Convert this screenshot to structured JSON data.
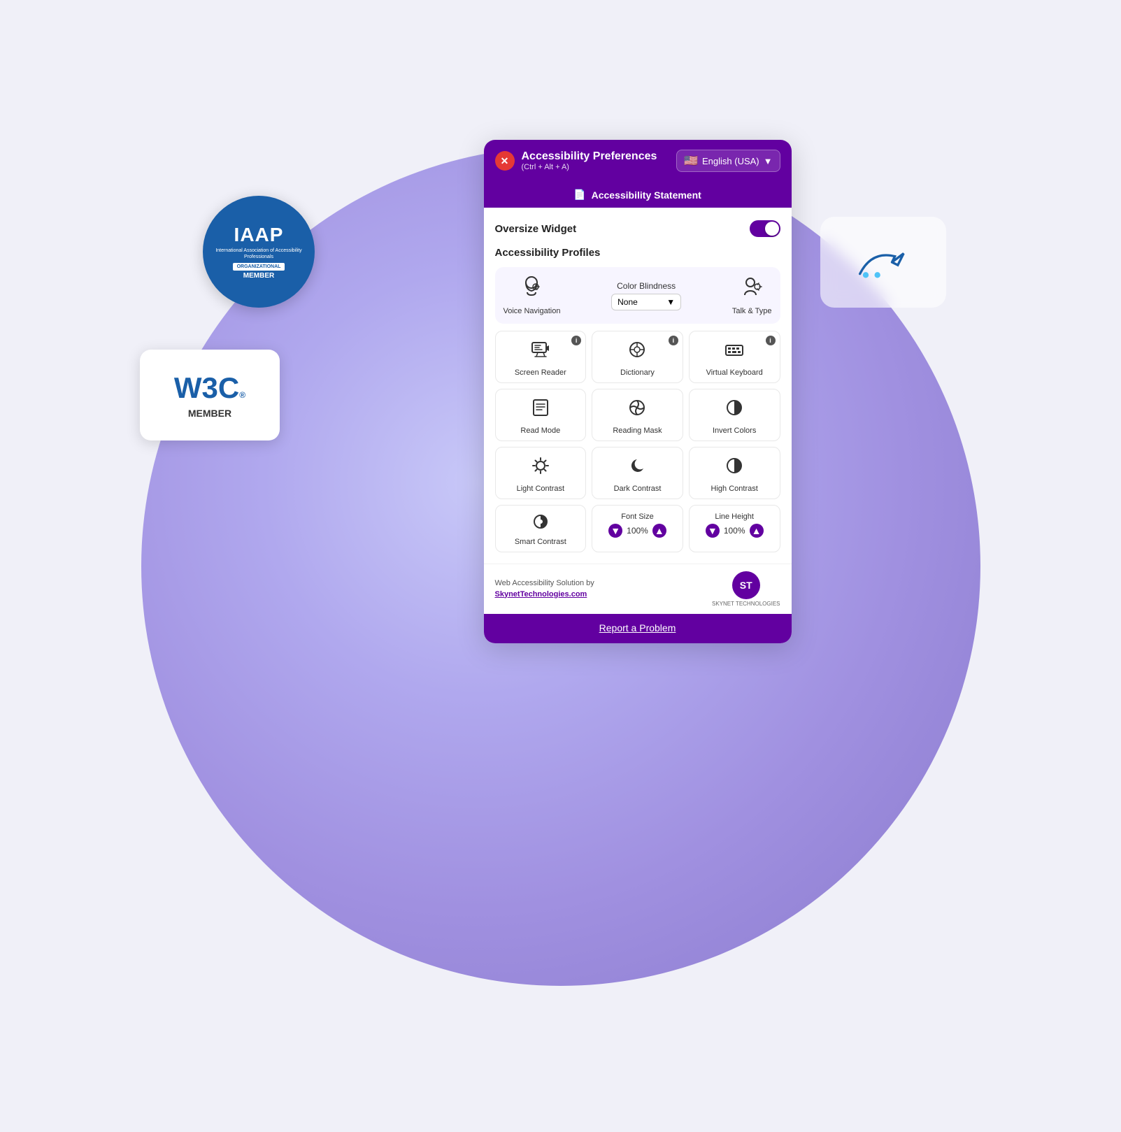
{
  "background": {
    "circle_color": "#a090e0"
  },
  "iaap_badge": {
    "title": "IAAP",
    "subtitle": "International Association of Accessibility Professionals",
    "org_label": "ORGANIZATIONAL",
    "member_label": "MEMBER"
  },
  "w3c_badge": {
    "logo": "W3C",
    "reg": "®",
    "member": "MEMBER"
  },
  "widget": {
    "header": {
      "close_label": "✕",
      "title": "Accessibility Preferences",
      "shortcut": "(Ctrl + Alt + A)",
      "lang_flag": "🇺🇸",
      "lang_label": "English (USA)",
      "lang_arrow": "▼"
    },
    "statement_bar": {
      "icon": "📄",
      "label": "Accessibility Statement"
    },
    "body": {
      "oversize_label": "Oversize Widget",
      "toggle_on": true,
      "profiles_label": "Accessibility Profiles",
      "voice_nav_label": "Voice Navigation",
      "color_blindness_label": "Color Blindness",
      "color_blindness_default": "None",
      "talk_type_label": "Talk & Type",
      "screen_reader_label": "Screen Reader",
      "dictionary_label": "Dictionary",
      "virtual_keyboard_label": "Virtual Keyboard",
      "read_mode_label": "Read Mode",
      "reading_mask_label": "Reading Mask",
      "invert_colors_label": "Invert Colors",
      "light_contrast_label": "Light Contrast",
      "dark_contrast_label": "Dark Contrast",
      "high_contrast_label": "High Contrast",
      "smart_contrast_label": "Smart Contrast",
      "font_size_label": "Font Size",
      "font_size_value": "100%",
      "line_height_label": "Line Height",
      "line_height_value": "100%"
    },
    "footer": {
      "text1": "Web Accessibility Solution by",
      "link": "SkynetTechnologies.com",
      "logo_text": "ST"
    },
    "report_bar": {
      "label": "Report a Problem"
    }
  }
}
